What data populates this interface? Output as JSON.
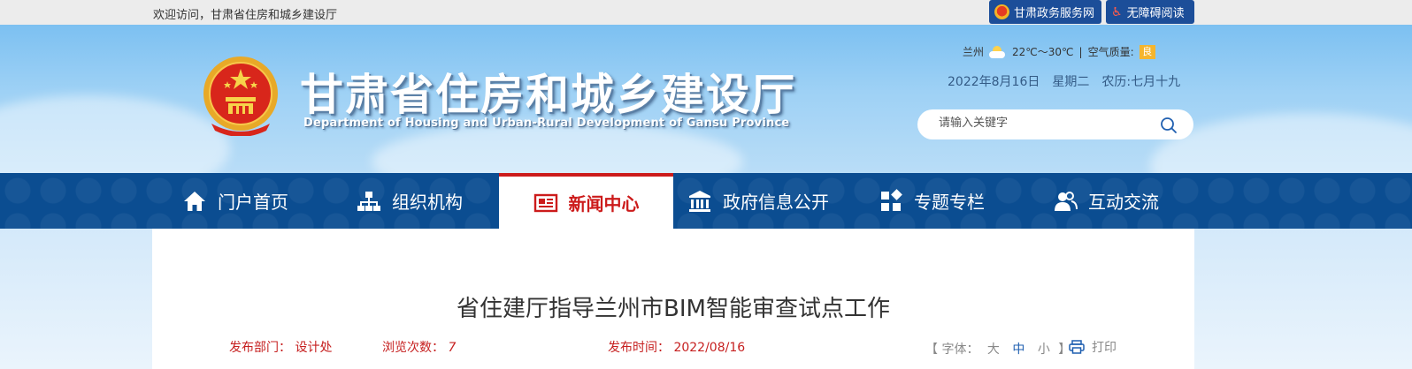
{
  "topbar": {
    "welcome": "欢迎访问，甘肃省住房和城乡建设厅",
    "gov_service": "甘肃政务服务网",
    "accessibility": "无障碍阅读"
  },
  "header": {
    "title": "甘肃省住房和城乡建设厅",
    "subtitle": "Department of Housing and Urban-Rural Development of Gansu Province",
    "weather": {
      "city": "兰州",
      "temp": "22℃～30℃",
      "separator": "|",
      "aq_label": "空气质量:",
      "aq_value": "良"
    },
    "date": "2022年8月16日　星期二　农历:七月十九",
    "search": {
      "placeholder": "请输入关键字"
    }
  },
  "nav": {
    "items": [
      {
        "label": "门户首页",
        "icon": "home-icon"
      },
      {
        "label": "组织机构",
        "icon": "org-chart-icon"
      },
      {
        "label": "新闻中心",
        "icon": "newspaper-icon",
        "active": true
      },
      {
        "label": "政府信息公开",
        "icon": "government-building-icon"
      },
      {
        "label": "专题专栏",
        "icon": "grid-icon"
      },
      {
        "label": "互动交流",
        "icon": "users-icon"
      }
    ]
  },
  "article": {
    "title": "省住建厅指导兰州市BIM智能审查试点工作",
    "dept_label": "发布部门：",
    "dept_value": "设计处",
    "views_label": "浏览次数：",
    "views_value": "7",
    "time_label": "发布时间：",
    "time_value": "2022/08/16",
    "font_label": "【 字体：",
    "font_large": "大",
    "font_medium": "中",
    "font_small": "小",
    "font_close": "】",
    "print_label": "打印"
  },
  "colors": {
    "nav_bg": "#0b4d91",
    "accent_red": "#cc1b1b",
    "topbar_button": "#1c4e99"
  }
}
